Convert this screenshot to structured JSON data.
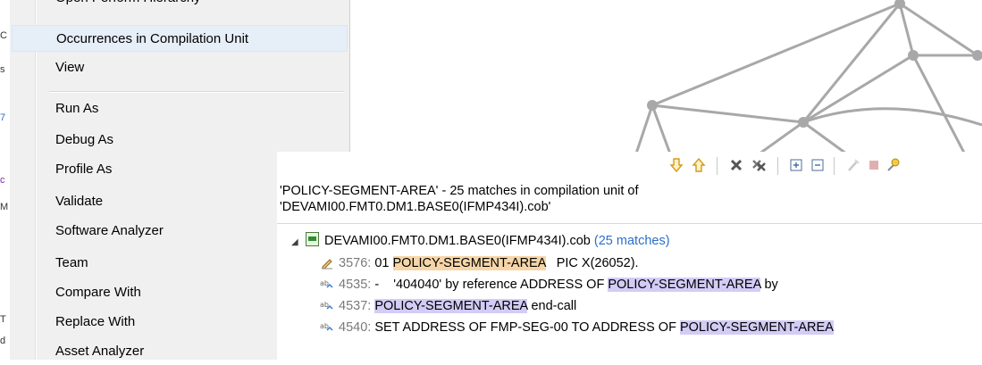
{
  "left_strip": {
    "glyphs": [
      "C",
      "s",
      "7",
      "c",
      "M",
      "T",
      "d"
    ]
  },
  "menu": {
    "partial_top_item": "Open Perform Hierarchy",
    "items": [
      {
        "label": "Occurrences in Compilation Unit",
        "hover": true
      },
      {
        "label": "View"
      },
      {
        "label": "Run As"
      },
      {
        "label": "Debug As"
      },
      {
        "label": "Profile As"
      },
      {
        "label": "Validate"
      },
      {
        "label": "Software Analyzer"
      },
      {
        "label": "Team"
      },
      {
        "label": "Compare With"
      },
      {
        "label": "Replace With"
      },
      {
        "label": "Asset Analyzer"
      }
    ]
  },
  "search": {
    "toolbar_icons": [
      "next-match-icon",
      "previous-match-icon",
      "remove-match-icon",
      "remove-all-matches-icon",
      "expand-all-icon",
      "collapse-all-icon",
      "clear-history-icon",
      "stop-search-icon",
      "pin-icon"
    ],
    "header_line1": "'POLICY-SEGMENT-AREA' - 25 matches in compilation unit of",
    "header_line2": "'DEVAMI00.FMT0.DM1.BASE0(IFMP434I).cob'",
    "root": {
      "file": "DEVAMI00.FMT0.DM1.BASE0(IFMP434I).cob",
      "count": "(25 matches)"
    },
    "matches": [
      {
        "line": "3576:",
        "pre": "01 ",
        "hit": "POLICY-SEGMENT-AREA",
        "post": "   PIC X(26052).",
        "kind": "write"
      },
      {
        "line": "4535:",
        "pre": "-    '404040' by reference ADDRESS OF ",
        "hit": "POLICY-SEGMENT-AREA",
        "post": " by",
        "kind": "read"
      },
      {
        "line": "4537:",
        "pre": "",
        "hit": "POLICY-SEGMENT-AREA",
        "post": " end-call",
        "kind": "read"
      },
      {
        "line": "4540:",
        "pre": "SET ADDRESS OF FMP-SEG-00 TO ADDRESS OF ",
        "hit": "POLICY-SEGMENT-AREA",
        "post": "",
        "kind": "read"
      }
    ]
  }
}
